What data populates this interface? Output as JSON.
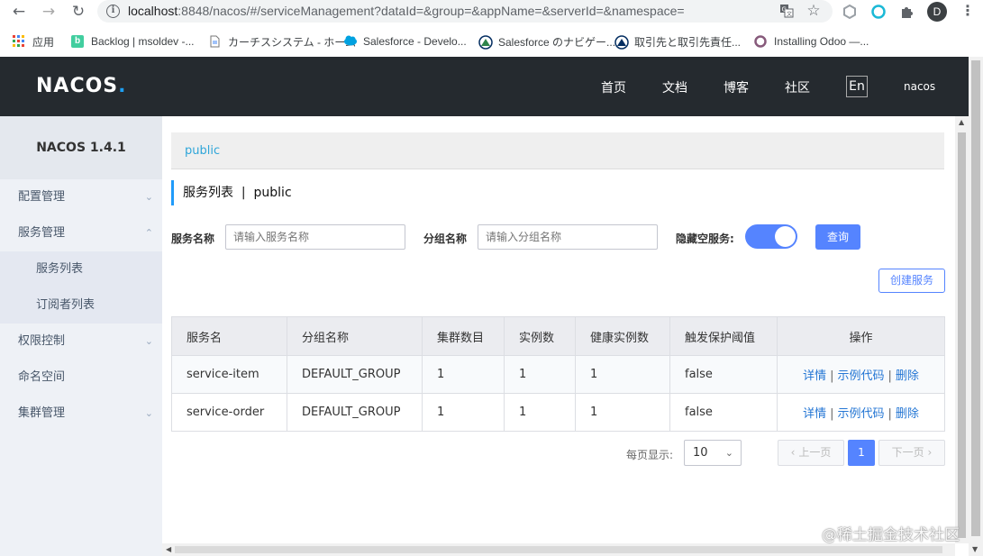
{
  "browser": {
    "url_host": "localhost",
    "url_rest": ":8848/nacos/#/serviceManagement?dataId=&group=&appName=&serverId=&namespace=",
    "profile_initial": "D",
    "bookmarks": [
      {
        "label": "应用"
      },
      {
        "label": "Backlog | msoldev -..."
      },
      {
        "label": "カーチスシステム - ホーム"
      },
      {
        "label": "Salesforce - Develo..."
      },
      {
        "label": "Salesforce のナビゲー..."
      },
      {
        "label": "取引先と取引先責任..."
      },
      {
        "label": "Installing Odoo —..."
      }
    ]
  },
  "header": {
    "logo_main": "NACOS",
    "logo_dot": ".",
    "nav": [
      "首页",
      "文档",
      "博客",
      "社区"
    ],
    "lang": "En",
    "user": "nacos"
  },
  "sidebar": {
    "version": "NACOS 1.4.1",
    "items": [
      {
        "label": "配置管理"
      },
      {
        "label": "服务管理"
      },
      {
        "label": "服务列表"
      },
      {
        "label": "订阅者列表"
      },
      {
        "label": "权限控制"
      },
      {
        "label": "命名空间"
      },
      {
        "label": "集群管理"
      }
    ]
  },
  "main": {
    "namespace": "public",
    "page_title": "服务列表  |  public",
    "filters": {
      "service_name_label": "服务名称",
      "service_name_placeholder": "请输入服务名称",
      "group_name_label": "分组名称",
      "group_name_placeholder": "请输入分组名称",
      "hide_empty_label": "隐藏空服务:",
      "hide_empty_on": true,
      "query_button": "查询"
    },
    "create_button": "创建服务",
    "table": {
      "headers": [
        "服务名",
        "分组名称",
        "集群数目",
        "实例数",
        "健康实例数",
        "触发保护阈值",
        "操作"
      ],
      "rows": [
        {
          "name": "service-item",
          "group": "DEFAULT_GROUP",
          "clusters": "1",
          "instances": "1",
          "healthy": "1",
          "threshold": "false"
        },
        {
          "name": "service-order",
          "group": "DEFAULT_GROUP",
          "clusters": "1",
          "instances": "1",
          "healthy": "1",
          "threshold": "false"
        }
      ],
      "actions": {
        "detail": "详情",
        "sample": "示例代码",
        "delete": "删除",
        "separator": "|"
      }
    },
    "pagination": {
      "page_size_label": "每页显示:",
      "page_size": "10",
      "prev": "上一页",
      "next": "下一页",
      "current": "1"
    }
  },
  "watermark": "@稀土掘金技术社区",
  "colors": {
    "header_bg": "#252a2f",
    "primary": "#5584ff",
    "link": "#2476d4",
    "sidebar_bg": "#eef1f6"
  }
}
